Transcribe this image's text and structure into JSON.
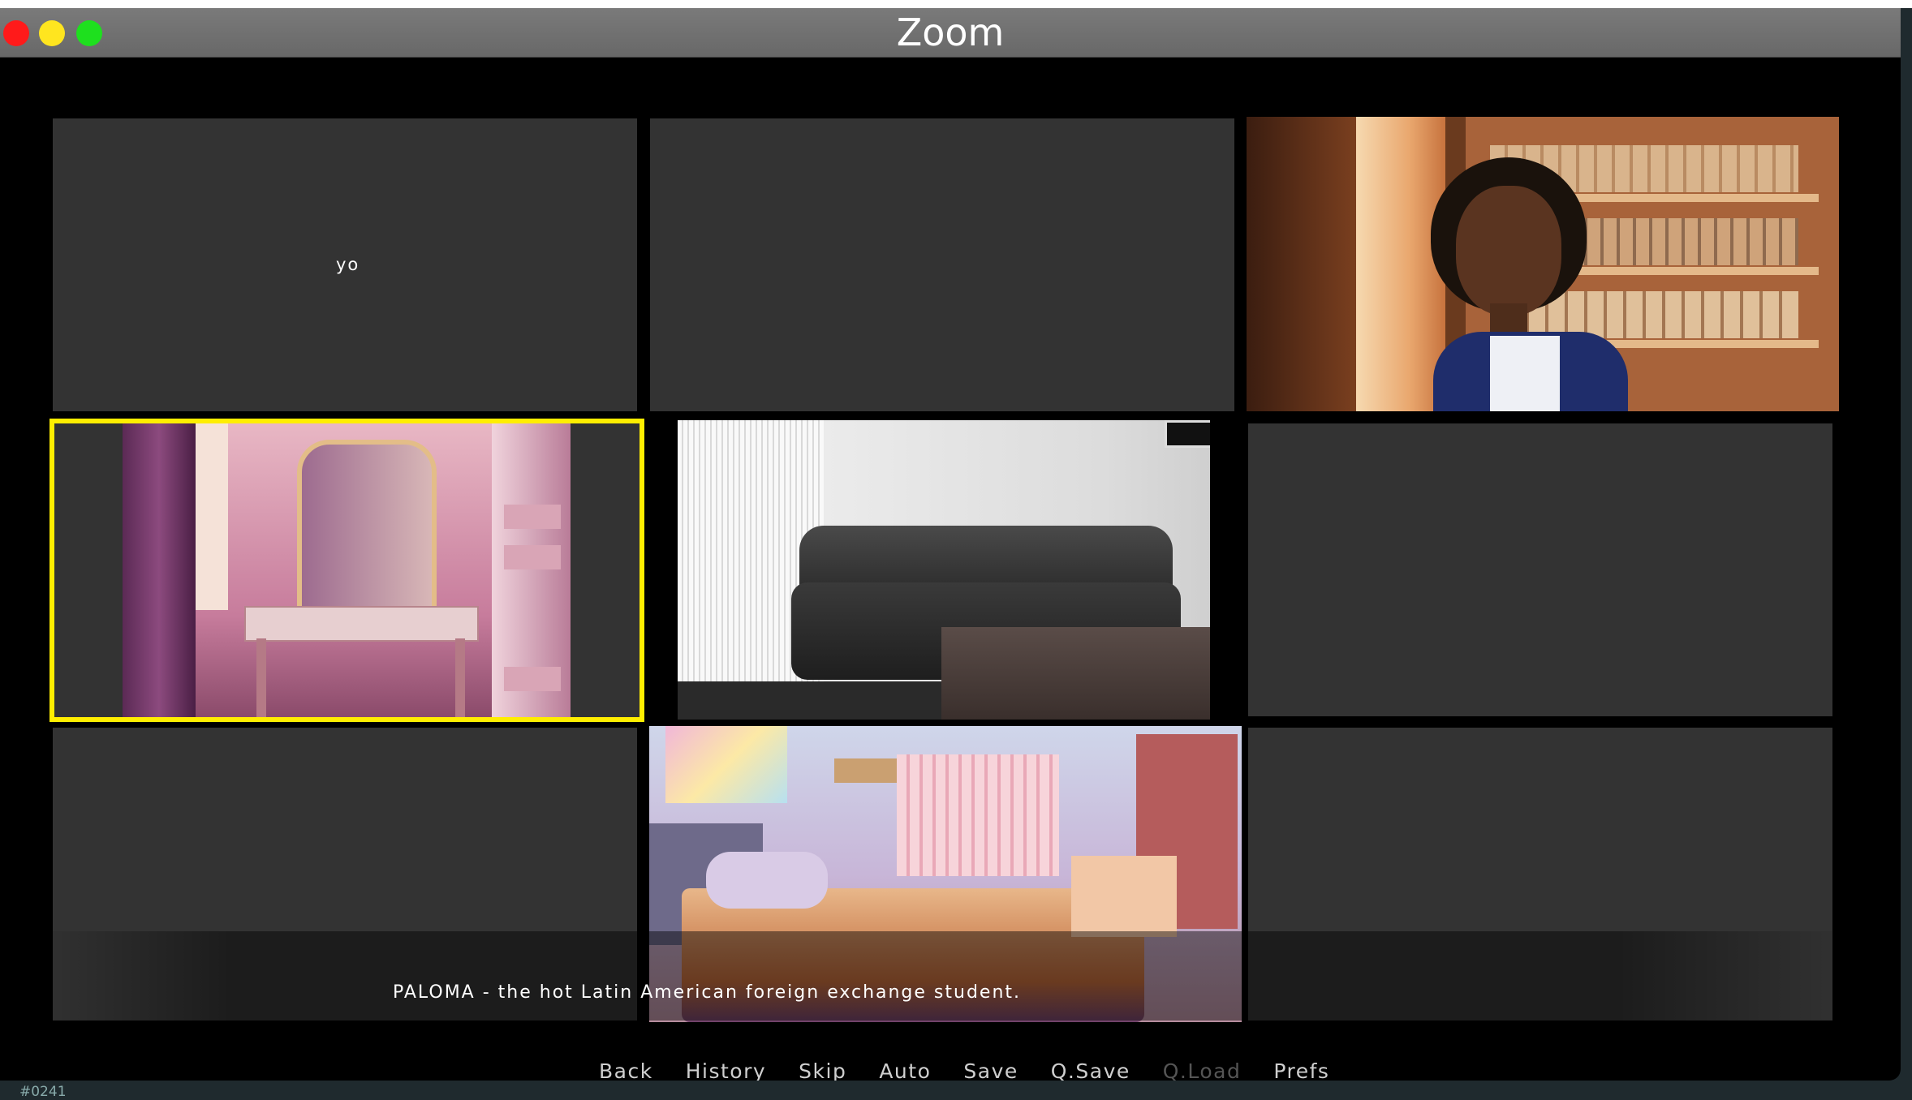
{
  "window": {
    "title": "Zoom"
  },
  "tiles": {
    "top_left_name": "yo"
  },
  "dialog": {
    "text": "PALOMA - the hot Latin American foreign exchange student."
  },
  "menu": {
    "back": "Back",
    "history": "History",
    "skip": "Skip",
    "auto": "Auto",
    "save": "Save",
    "qsave": "Q.Save",
    "qload": "Q.Load",
    "prefs": "Prefs"
  },
  "background_app": {
    "label": "#0241"
  },
  "colors": {
    "highlight": "#ffee00",
    "tile_empty": "#333333",
    "traffic_red": "#ff1a1a",
    "traffic_yellow": "#ffe51f",
    "traffic_green": "#1ee01e"
  }
}
